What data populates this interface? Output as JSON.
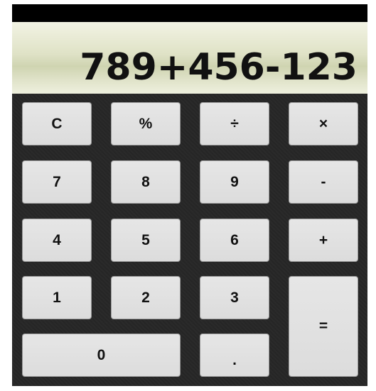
{
  "display": {
    "value": "789+456-123"
  },
  "keys": {
    "clear": "C",
    "percent": "%",
    "divide": "÷",
    "multiply": "×",
    "seven": "7",
    "eight": "8",
    "nine": "9",
    "minus": "-",
    "four": "4",
    "five": "5",
    "six": "6",
    "plus": "+",
    "one": "1",
    "two": "2",
    "three": "3",
    "equals": "=",
    "zero": "0",
    "decimal": "."
  }
}
